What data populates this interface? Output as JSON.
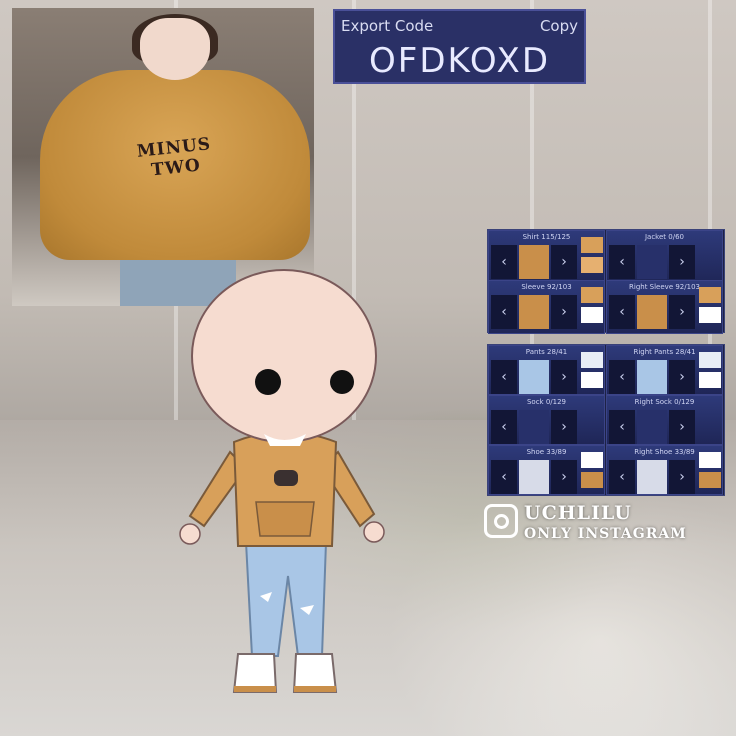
{
  "photo": {
    "sweater_text": "MINUS TWO"
  },
  "export": {
    "label": "Export Code",
    "copy_label": "Copy",
    "code": "OFDKOXD"
  },
  "panel_top": {
    "slots": [
      {
        "title": "Shirt 115/125"
      },
      {
        "title": "Jacket 0/60"
      },
      {
        "title": "Sleeve 92/103"
      },
      {
        "title": "Right Sleeve 92/103"
      }
    ]
  },
  "panel_bottom": {
    "slots": [
      {
        "title": "Pants 28/41"
      },
      {
        "title": "Right Pants 28/41"
      },
      {
        "title": "Sock 0/129"
      },
      {
        "title": "Right Sock 0/129"
      },
      {
        "title": "Shoe 33/89"
      },
      {
        "title": "Right Shoe 33/89"
      }
    ]
  },
  "watermark": {
    "name": "UCHLILU",
    "sub": "ONLY INSTAGRAM"
  },
  "colors": {
    "sweater": "#d8a05a",
    "jeans": "#a9c6e6",
    "panel": "#1f2657"
  }
}
